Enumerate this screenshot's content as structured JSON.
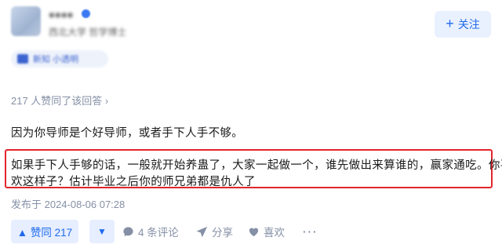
{
  "author": {
    "name": "●●●●",
    "subtitle": "西北大学 哲学博士",
    "badge": "新知 小透明"
  },
  "follow_button": {
    "label": "关注"
  },
  "agree_line": "217 人赞同了该回答 ›",
  "answer": {
    "paragraph1": "因为你导师是个好导师，或者手下人手不够。",
    "highlight_line1": "如果手下人手够的话，一般就开始养蛊了，大家一起做一个，谁先做出来算谁的，赢家通吃。你喜",
    "highlight_line2": "欢这样子？估计毕业之后你的师兄弟都是仇人了"
  },
  "published": "发布于 2024-08-06 07:28",
  "actions": {
    "upvote_label": "▲ 赞同 217",
    "comment_label": "4 条评论",
    "share_label": "分享",
    "like_label": "喜欢",
    "more_label": "···"
  },
  "colors": {
    "accent": "#1f6aeb",
    "highlight_border": "#e3262c",
    "muted_text": "#8590a6"
  }
}
